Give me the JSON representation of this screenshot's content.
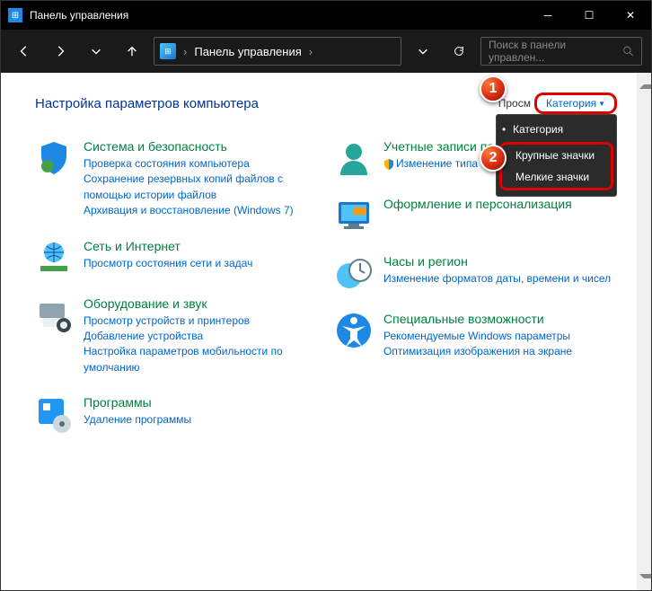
{
  "titlebar": {
    "title": "Панель управления"
  },
  "nav": {
    "address": "Панель управления",
    "search_placeholder": "Поиск в панели управлен..."
  },
  "header": {
    "title": "Настройка параметров компьютера",
    "viewby_label": "Просм",
    "viewby_value": "Категория"
  },
  "dropdown": {
    "opt1": "Категория",
    "opt2": "Крупные значки",
    "opt3": "Мелкие значки"
  },
  "badges": {
    "b1": "1",
    "b2": "2"
  },
  "left": {
    "c1": {
      "title": "Система и безопасность",
      "l1": "Проверка состояния компьютера",
      "l2": "Сохранение резервных копий файлов с помощью истории файлов",
      "l3": "Архивация и восстановление (Windows 7)"
    },
    "c2": {
      "title": "Сеть и Интернет",
      "l1": "Просмотр состояния сети и задач"
    },
    "c3": {
      "title": "Оборудование и звук",
      "l1": "Просмотр устройств и принтеров",
      "l2": "Добавление устройства",
      "l3": "Настройка параметров мобильности по умолчанию"
    },
    "c4": {
      "title": "Программы",
      "l1": "Удаление программы"
    }
  },
  "right": {
    "c1": {
      "title": "Учетные записи пользователей",
      "l1": "Изменение типа"
    },
    "c2": {
      "title": "Оформление и персонализация"
    },
    "c3": {
      "title": "Часы и регион",
      "l1": "Изменение форматов даты, времени и чисел"
    },
    "c4": {
      "title": "Специальные возможности",
      "l1": "Рекомендуемые Windows параметры",
      "l2": "Оптимизация изображения на экране"
    }
  }
}
